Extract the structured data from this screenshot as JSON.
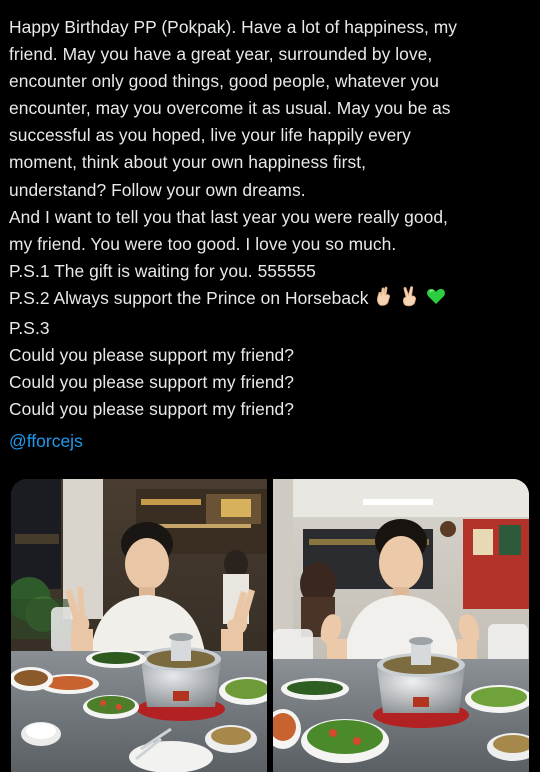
{
  "tweet": {
    "lines": [
      "Happy Birthday PP (Pokpak). Have a lot of happiness, my",
      "friend. May you have a great year, surrounded by love,",
      "encounter only good things, good people, whatever you",
      "encounter, may you overcome it as usual. May you be as",
      "successful as you hoped, live your life happily every",
      "moment, think about your own happiness first,",
      "understand? Follow your own dreams.",
      "And I want to tell you that last year you were really good,",
      "my friend. You were too good. I love you so much.",
      "P.S.1 The gift is waiting for you. 555555",
      "P.S.2 Always support the Prince on Horseback",
      "P.S.3",
      "Could you please support my friend?",
      "Could you please support my friend?",
      "Could you please support my friend?"
    ],
    "mention": "@fforcejs",
    "emojis": [
      "crossed-fingers-emoji",
      "victory-hand-emoji",
      "green-heart-emoji"
    ]
  },
  "media": {
    "count": 2,
    "alt": [
      "photo-restaurant-left",
      "photo-restaurant-right"
    ]
  },
  "colors": {
    "background": "#000000",
    "text": "#e7e9ea",
    "link": "#1d9bf0",
    "heart": "#2ecc40"
  }
}
